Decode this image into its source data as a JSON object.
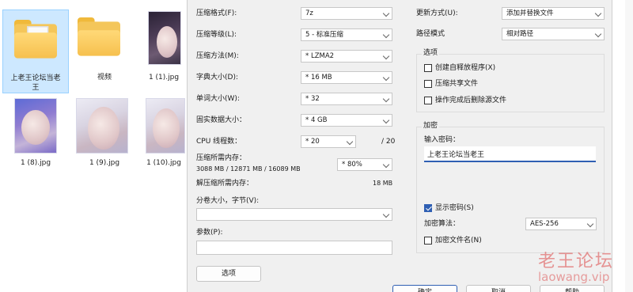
{
  "explorer": {
    "items": [
      {
        "label": "上老王论坛当老王"
      },
      {
        "label": "视频"
      },
      {
        "label": "1 (1).jpg"
      },
      {
        "label": "1 (8).jpg"
      },
      {
        "label": "1 (9).jpg"
      },
      {
        "label": "1 (10).jpg"
      }
    ]
  },
  "dialog": {
    "format": {
      "label": "压缩格式(F):",
      "value": "7z"
    },
    "level": {
      "label": "压缩等级(L):",
      "value": "5 - 标准压缩"
    },
    "method": {
      "label": "压缩方法(M):",
      "value": "* LZMA2"
    },
    "dict": {
      "label": "字典大小(D):",
      "value": "* 16 MB"
    },
    "word": {
      "label": "单词大小(W):",
      "value": "* 32"
    },
    "solid": {
      "label": "固实数据大小：",
      "value": "* 4 GB"
    },
    "threads": {
      "label": "CPU 线程数：",
      "value": "* 20",
      "max": "/ 20"
    },
    "mem_comp": {
      "label": "压缩所需内存：",
      "detail": "3088 MB / 12871 MB / 16089 MB",
      "value": "* 80%"
    },
    "mem_decomp": {
      "label": "解压缩所需内存：",
      "value": "18 MB"
    },
    "split": {
      "label": "分卷大小，字节(V):",
      "value": ""
    },
    "params": {
      "label": "参数(P):",
      "value": ""
    },
    "options_button": "选项",
    "update": {
      "label": "更新方式(U):",
      "value": "添加并替换文件"
    },
    "path": {
      "label": "路径模式",
      "value": "相对路径"
    },
    "options": {
      "title": "选项",
      "sfx": "创建自释放程序(X)",
      "shared": "压缩共享文件",
      "delete": "操作完成后删除源文件"
    },
    "encryption": {
      "title": "加密",
      "password_label": "输入密码：",
      "password_value": "上老王论坛当老王",
      "show_password": "显示密码(S)",
      "method_label": "加密算法：",
      "method_value": "AES-256",
      "encrypt_names": "加密文件名(N)"
    },
    "buttons": {
      "ok": "确定",
      "cancel": "取消",
      "help": "帮助"
    }
  },
  "watermark": {
    "cn": "老王论坛",
    "en": "laowang.vip"
  },
  "colors": {
    "accent": "#2f5fb3",
    "folder": "#f4c65a",
    "selection": "#cde8ff",
    "watermark": "#dc4646"
  }
}
